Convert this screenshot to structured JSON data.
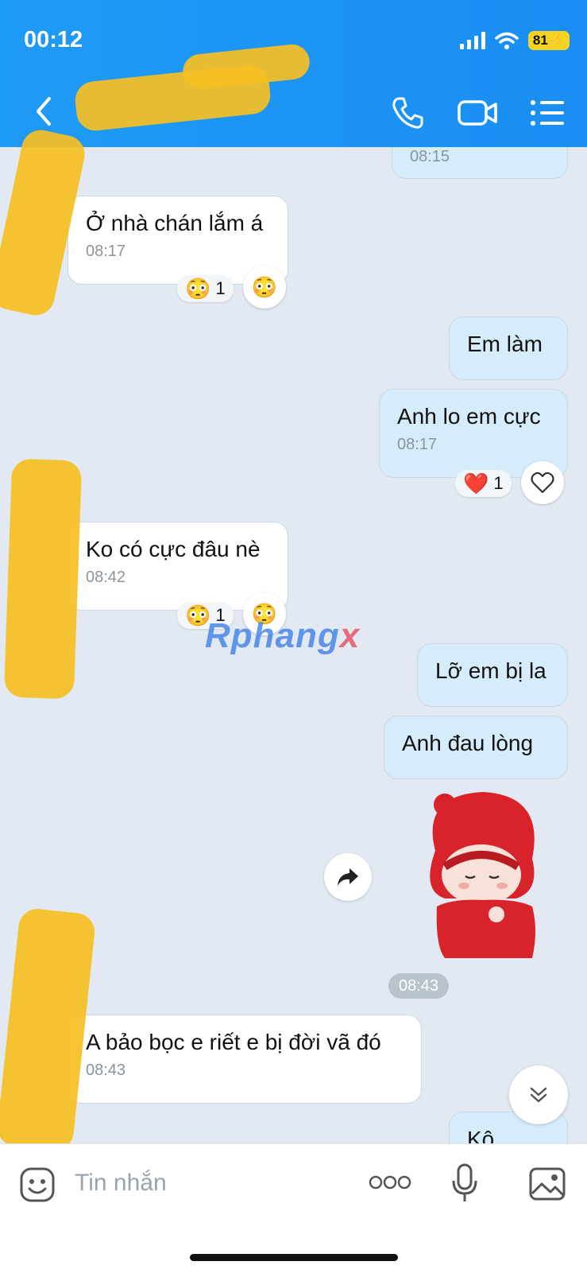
{
  "status_bar": {
    "time": "00:12",
    "battery": "81"
  },
  "messages": [
    {
      "text": "Ở nhà chán lắm á",
      "time": "08:17",
      "direction": "in",
      "reaction": {
        "emoji": "😳",
        "count": "1"
      }
    },
    {
      "text": "Em làm",
      "time": "",
      "direction": "out"
    },
    {
      "text": "Anh lo em cực",
      "time": "08:17",
      "direction": "out",
      "reaction": {
        "emoji": "❤️",
        "count": "1"
      }
    },
    {
      "text": "Ko có cực đâu nè",
      "time": "08:42",
      "direction": "in",
      "reaction": {
        "emoji": "😳",
        "count": "1"
      }
    },
    {
      "text": "Lỡ em bị la",
      "time": "",
      "direction": "out"
    },
    {
      "text": "Anh đau lòng",
      "time": "",
      "direction": "out"
    },
    {
      "text": "A bảo bọc e riết e bị đời vã đó",
      "time": "08:43",
      "direction": "in"
    },
    {
      "text": "Kô",
      "time": "",
      "direction": "out"
    }
  ],
  "top_partial_time": "08:15",
  "sticker_time": "08:43",
  "watermark": {
    "main": "Rphang",
    "tail": "x"
  },
  "composer": {
    "placeholder": "Tin nhắn"
  },
  "colors": {
    "header": "#1e9bf6",
    "outgoing_bubble": "#d6ecfb",
    "incoming_bubble": "#ffffff",
    "background": "#e2e9f2",
    "redaction": "#f6bf22"
  },
  "icons": [
    "back-icon",
    "phone-icon",
    "video-call-icon",
    "menu-list-icon",
    "share-icon",
    "scroll-down-icon",
    "sticker-face-icon",
    "more-icon",
    "microphone-icon",
    "image-icon",
    "heart-outline-icon",
    "surprised-emoji-icon"
  ]
}
